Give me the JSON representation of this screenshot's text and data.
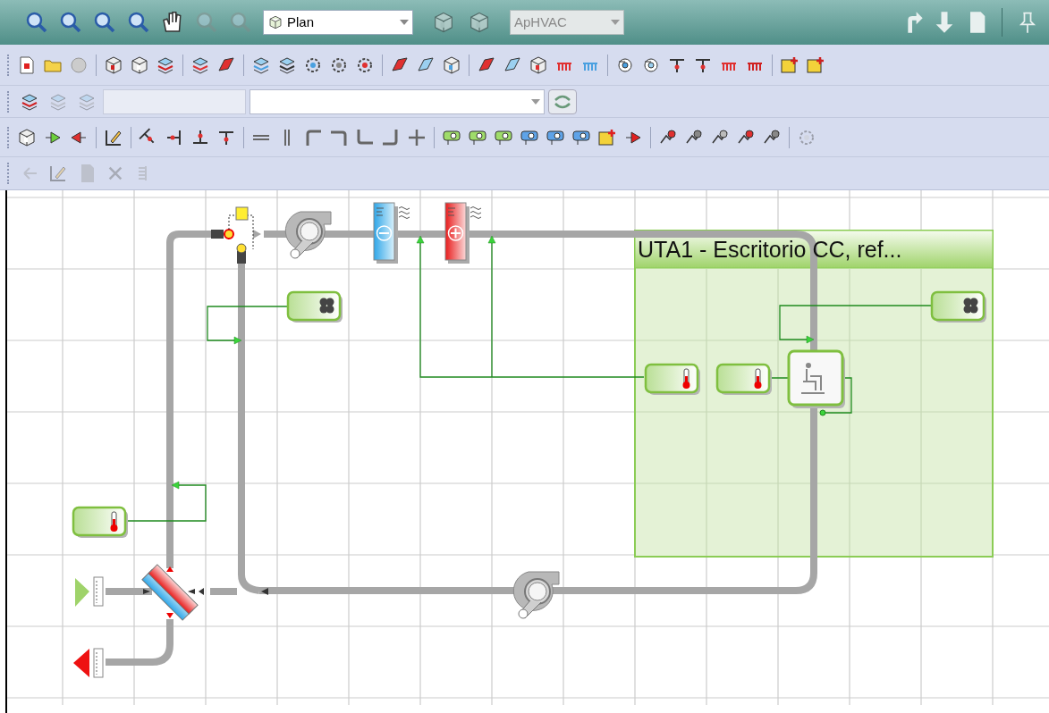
{
  "top_toolbar": {
    "view_dropdown": {
      "value": "Plan"
    },
    "mode_dropdown": {
      "value": "ApHVAC",
      "disabled": true
    }
  },
  "diagram": {
    "zone": {
      "label": "UTA1 - Escritorio CC, ref..."
    }
  }
}
